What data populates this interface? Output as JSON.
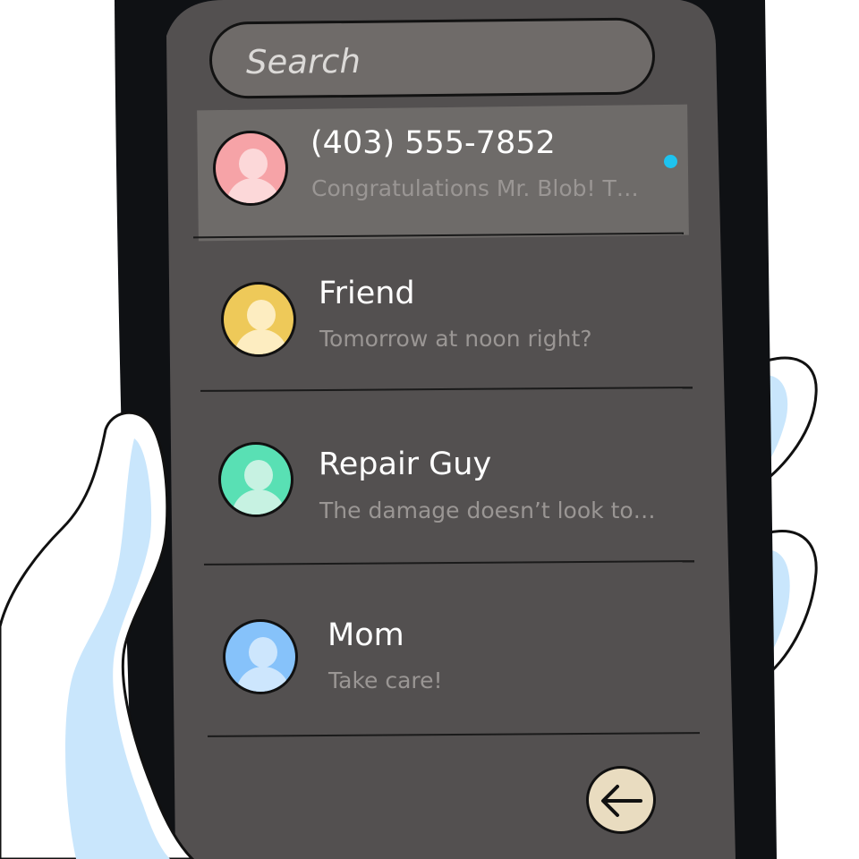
{
  "search": {
    "placeholder": "Search"
  },
  "conversations": [
    {
      "name": "(403) 555-7852",
      "preview": "Congratulations Mr. Blob! T…",
      "unread": true,
      "avatar_color": "#f6a3a7",
      "avatar_light": "#fcd8d9"
    },
    {
      "name": "Friend",
      "preview": "Tomorrow at noon right?",
      "unread": false,
      "avatar_color": "#eec959",
      "avatar_light": "#fdedc1"
    },
    {
      "name": "Repair Guy",
      "preview": "The damage doesn’t look to…",
      "unread": false,
      "avatar_color": "#59e0b4",
      "avatar_light": "#c7f2e2"
    },
    {
      "name": "Mom",
      "preview": "Take care!",
      "unread": false,
      "avatar_color": "#86c2fa",
      "avatar_light": "#cde6fd"
    }
  ],
  "back_button": {
    "icon": "arrow-left-icon",
    "color": "#e9dcc0"
  },
  "colors": {
    "screen": "#535050",
    "phone_body": "#0f1114",
    "unread_dot": "#1ec3ef",
    "hand_fill": "#c9e6fc"
  }
}
